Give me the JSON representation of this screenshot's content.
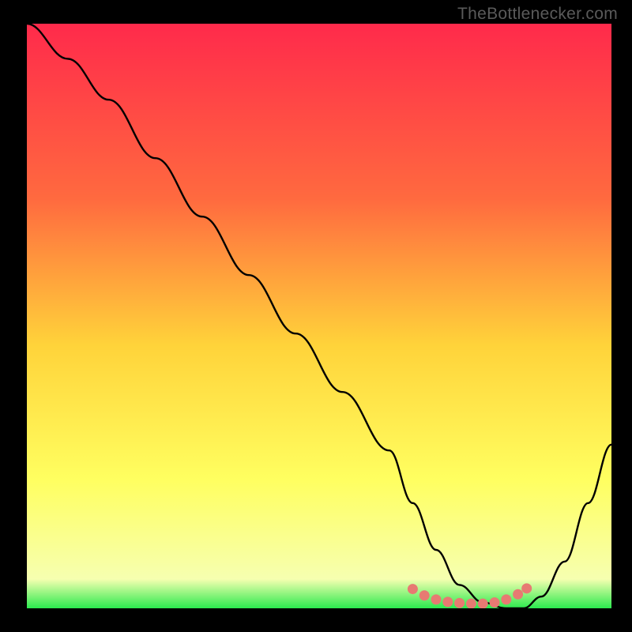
{
  "watermark": "TheBottlenecker.com",
  "chart_data": {
    "type": "line",
    "title": "",
    "xlabel": "",
    "ylabel": "",
    "xlim": [
      0,
      100
    ],
    "ylim": [
      0,
      100
    ],
    "background_gradient": {
      "stops": [
        {
          "offset": 0,
          "color": "#ff2a4b"
        },
        {
          "offset": 30,
          "color": "#ff6a3f"
        },
        {
          "offset": 55,
          "color": "#ffd33a"
        },
        {
          "offset": 78,
          "color": "#ffff60"
        },
        {
          "offset": 95,
          "color": "#f6ffb0"
        },
        {
          "offset": 100,
          "color": "#2bea4e"
        }
      ]
    },
    "series": [
      {
        "name": "curve",
        "color": "#000000",
        "x": [
          0,
          7,
          14,
          22,
          30,
          38,
          46,
          54,
          62,
          66,
          70,
          74,
          78,
          82,
          85,
          88,
          92,
          96,
          100
        ],
        "y": [
          100,
          94,
          87,
          77,
          67,
          57,
          47,
          37,
          27,
          18,
          10,
          4,
          1,
          0,
          0,
          2,
          8,
          18,
          28
        ]
      }
    ],
    "markers": {
      "name": "bottom-cluster",
      "color": "#e77a72",
      "points": [
        {
          "x": 66,
          "y": 3.3
        },
        {
          "x": 68,
          "y": 2.2
        },
        {
          "x": 70,
          "y": 1.5
        },
        {
          "x": 72,
          "y": 1.1
        },
        {
          "x": 74,
          "y": 0.9
        },
        {
          "x": 76,
          "y": 0.8
        },
        {
          "x": 78,
          "y": 0.8
        },
        {
          "x": 80,
          "y": 1.0
        },
        {
          "x": 82,
          "y": 1.5
        },
        {
          "x": 84,
          "y": 2.4
        },
        {
          "x": 85.5,
          "y": 3.4
        }
      ]
    }
  }
}
